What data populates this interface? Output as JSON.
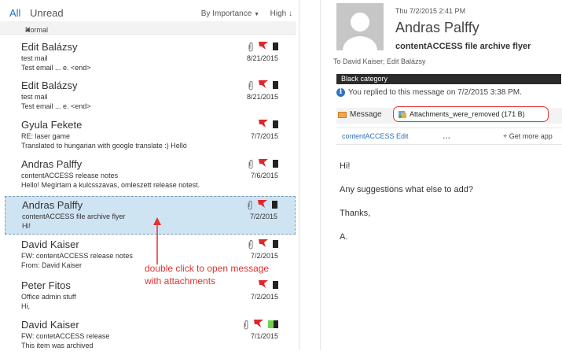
{
  "tabs": {
    "all": "All",
    "unread": "Unread"
  },
  "sort": {
    "label": "By Importance",
    "order": "High"
  },
  "group": {
    "label": "Normal"
  },
  "messages": [
    {
      "sender": "Edit Balázsy",
      "subject": "test mail",
      "preview": "Test email ... e. <end>",
      "date": "8/21/2015",
      "attachment": true,
      "flag": true,
      "category": "black"
    },
    {
      "sender": "Edit Balázsy",
      "subject": "test mail",
      "preview": "Test email ... e. <end>",
      "date": "8/21/2015",
      "attachment": true,
      "flag": true,
      "category": "black"
    },
    {
      "sender": "Gyula Fekete",
      "subject": "RE: laser game",
      "preview": "Translated to hungarian with google translate :) Helló",
      "date": "7/7/2015",
      "attachment": false,
      "flag": true,
      "category": "black"
    },
    {
      "sender": "Andras Palffy",
      "subject": "contentACCESS release notes",
      "preview": "Hello! Megírtam a kulcsszavas, omleszett release notest.",
      "date": "7/6/2015",
      "attachment": true,
      "flag": true,
      "category": "black"
    },
    {
      "sender": "Andras Palffy",
      "subject": "contentACCESS file archive flyer",
      "preview": "Hi!",
      "date": "7/2/2015",
      "attachment": true,
      "flag": true,
      "category": "black",
      "selected": true
    },
    {
      "sender": "David Kaiser",
      "subject": "FW: contentACCESS release notes",
      "preview": "From: David Kaiser",
      "date": "7/2/2015",
      "attachment": true,
      "flag": true,
      "category": "black"
    },
    {
      "sender": "Peter Fitos",
      "subject": "Office admin stuff",
      "preview": "Hi,",
      "date": "7/2/2015",
      "attachment": false,
      "flag": true,
      "category": "black"
    },
    {
      "sender": "David Kaiser",
      "subject": "FW: contetACCESS release",
      "preview": "This item was archived",
      "date": "7/1/2015",
      "attachment": true,
      "flag": true,
      "category": "black-green"
    }
  ],
  "annotation": {
    "line1": "double click to open message",
    "line2": "with attachments"
  },
  "reading": {
    "date": "Thu 7/2/2015 2:41 PM",
    "sender": "Andras Palffy",
    "subject": "contentACCESS file archive flyer",
    "to": "To   David Kaiser; Edit Balázsy",
    "category": "Black category",
    "replied": "You replied to this message on 7/2/2015 3:38 PM.",
    "message_tab": "Message",
    "attachment": "Attachments_were_removed (171 B)",
    "actions": {
      "edit": "contentACCESS Edit",
      "more": "...",
      "get": "+  Get more app"
    },
    "body": [
      "Hi!",
      "Any suggestions what else to add?",
      "Thanks,",
      "A."
    ]
  },
  "colors": {
    "accent": "#1a73c8",
    "flag": "#e0262b",
    "selected": "#cfe4f3",
    "annotation": "#e53030",
    "category": "#2b2b2b"
  }
}
